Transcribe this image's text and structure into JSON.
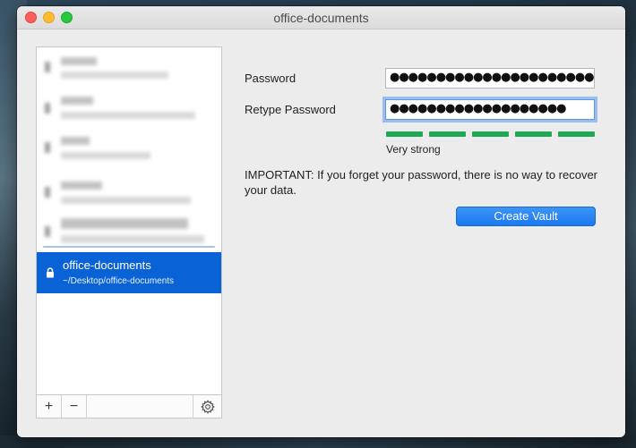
{
  "window": {
    "title": "office-documents"
  },
  "sidebar": {
    "selected_vault": {
      "name": "office-documents",
      "path": "~/Desktop/office-documents",
      "icon": "lock-icon"
    },
    "footer": {
      "add_label": "+",
      "remove_label": "−",
      "settings_icon": "gear-icon"
    }
  },
  "form": {
    "password_label": "Password",
    "password_value": "●●●●●●●●●●●●●●●●●●●●●●●",
    "retype_label": "Retype Password",
    "retype_value": "●●●●●●●●●●●●●●●●●●●",
    "strength": {
      "label": "Very strong",
      "level": 5,
      "max": 5,
      "color": "#1fa955",
      "empty_color": "#d0d0d0"
    },
    "important_text": "IMPORTANT: If you forget your password, there is no way to recover your data.",
    "create_button": "Create Vault"
  },
  "colors": {
    "accent": "#0a63d6",
    "button": "#1b79ef"
  }
}
